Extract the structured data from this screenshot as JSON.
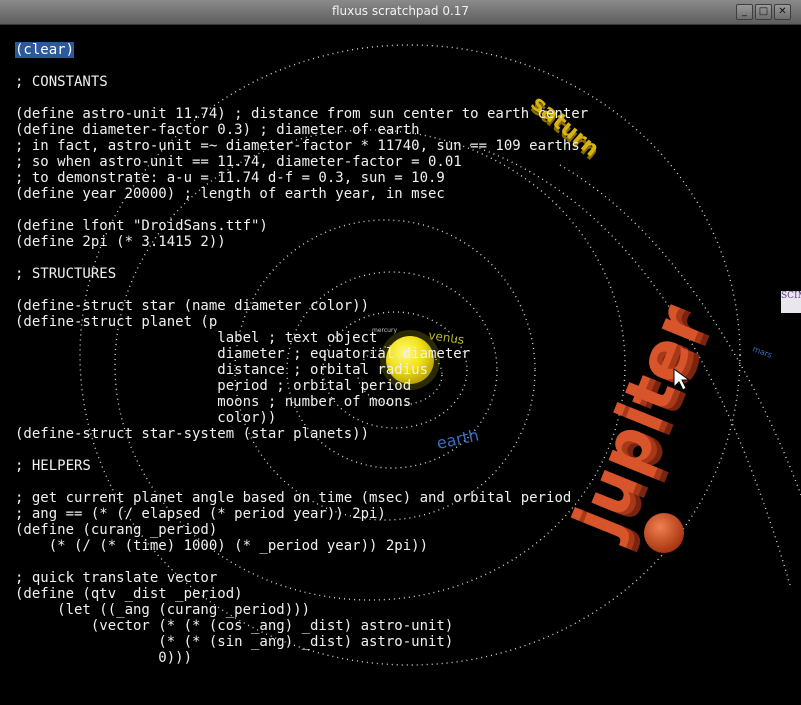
{
  "window": {
    "title": "fluxus scratchpad 0.17",
    "buttons": {
      "minimize": "_",
      "maximize": "□",
      "close": "✕"
    }
  },
  "editor": {
    "first_line": "(clear)",
    "lines": [
      "",
      "; CONSTANTS",
      "",
      "(define astro-unit 11.74) ; distance from sun center to earth center",
      "(define diameter-factor 0.3) ; diameter of earth",
      "; in fact, astro-unit =~ diameter-factor * 11740, sun == 109 earths",
      "; so when astro-unit == 11.74, diameter-factor = 0.01",
      "; to demonstrate: a-u = 11.74 d-f = 0.3, sun = 10.9",
      "(define year 20000) ; length of earth year, in msec",
      "",
      "(define lfont \"DroidSans.ttf\")",
      "(define 2pi (* 3.1415 2))",
      "",
      "; STRUCTURES",
      "",
      "(define-struct star (name diameter color))",
      "(define-struct planet (p",
      "                        label ; text object",
      "                        diameter ; equatorial diameter",
      "                        distance ; orbital radius",
      "                        period ; orbital period",
      "                        moons ; number of moons",
      "                        color))",
      "(define-struct star-system (star planets))",
      "",
      "; HELPERS",
      "",
      "; get current planet angle based on time (msec) and orbital period",
      "; ang == (* (/ elapsed (* period year)) 2pi)",
      "(define (curang _period)",
      "    (* (/ (* (time) 1000) (* _period year)) 2pi))",
      "",
      "; quick translate vector",
      "(define (qtv _dist _period)",
      "     (let ((_ang (curang _period)))",
      "         (vector (* (* (cos _ang) _dist) astro-unit)",
      "                 (* (* (sin _ang) _dist) astro-unit)",
      "                 0)))"
    ]
  },
  "scene": {
    "planet_labels": {
      "sun": "Sun",
      "venus": "venus",
      "earth": "earth",
      "jupiter": "jupiter",
      "mercury": "mercury",
      "mars": "mars",
      "saturn": "saturn"
    },
    "colors": {
      "sun": "#f2e21a",
      "venus": "#b8b820",
      "earth": "#3a6ec0",
      "jupiter": "#d8542a",
      "saturn_label": "#d8b410",
      "orbit": "#d8d8d8"
    },
    "edge_tag": "SCIM"
  }
}
